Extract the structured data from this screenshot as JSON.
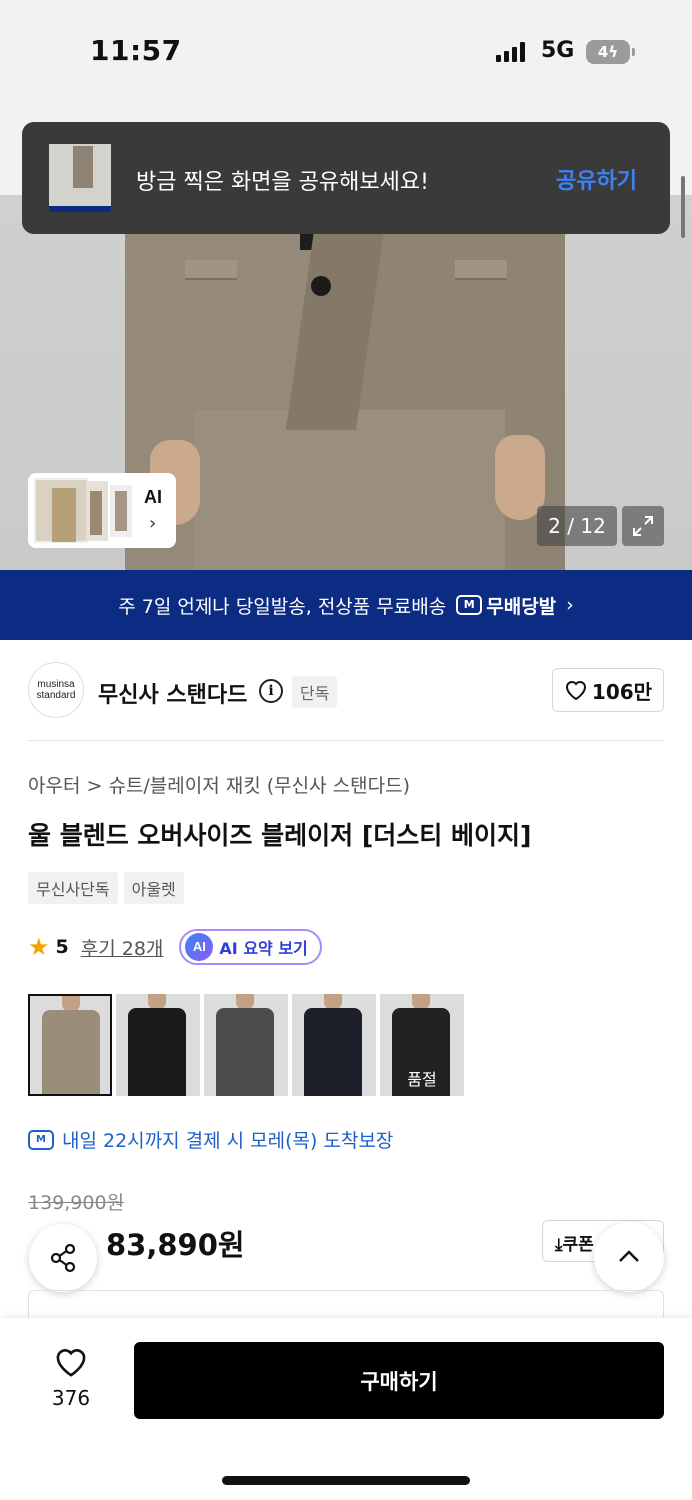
{
  "status_bar": {
    "time": "11:57",
    "network": "5G",
    "battery": "4"
  },
  "toast": {
    "message": "방금 찍은 화면을 공유해보세요!",
    "action": "공유하기"
  },
  "gallery": {
    "ai_label": "AI",
    "ai_chevron": "›",
    "counter": "2 / 12"
  },
  "banner": {
    "text": "주 7일 언제나 당일발송, 전상품 무료배송",
    "badge": "무배당발",
    "badge_icon": "M",
    "chevron": "›"
  },
  "brand": {
    "logo_line1": "musinsa",
    "logo_line2": "standard",
    "name": "무신사 스탠다드",
    "info_icon": "i",
    "exclusive": "단독",
    "likes": "106만"
  },
  "product": {
    "breadcrumb": "아우터 > 슈트/블레이저 재킷 (무신사 스탠다드)",
    "title": "울 블렌드 오버사이즈 블레이저 [더스티 베이지]",
    "tags": [
      "무신사단독",
      "아울렛"
    ],
    "rating": "5",
    "reviews": "후기 28개",
    "ai_summary": "AI 요약 보기",
    "ai_badge": "AI",
    "sold_out": "품절",
    "delivery": "내일 22시까지 결제 시 모레(목) 도착보장",
    "original_price": "139,900원",
    "price": "83,890원",
    "coupon": "쿠폰"
  },
  "colors": {
    "swatches": [
      "#9a8d7a",
      "#1a1a1a",
      "#4a4c4c",
      "#1c1f2a",
      "#222222"
    ]
  },
  "bottom": {
    "wish_count": "376",
    "buy_label": "구매하기"
  }
}
